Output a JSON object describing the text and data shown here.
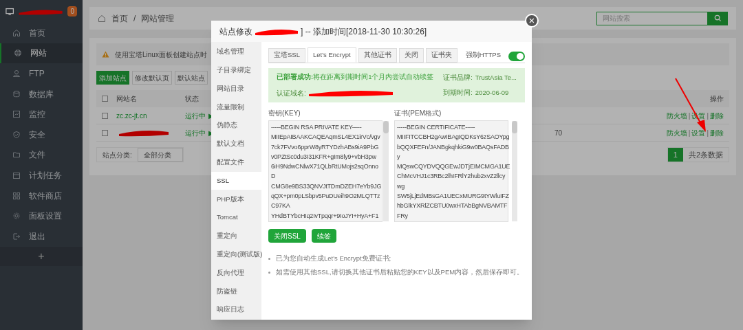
{
  "sidebar": {
    "logo": {
      "redacted": true
    },
    "badge": "0",
    "items": [
      {
        "label": "首页",
        "selected": false
      },
      {
        "label": "网站",
        "selected": true
      },
      {
        "label": "FTP",
        "selected": false
      },
      {
        "label": "数据库",
        "selected": false
      },
      {
        "label": "监控",
        "selected": false
      },
      {
        "label": "安全",
        "selected": false
      },
      {
        "label": "文件",
        "selected": false
      },
      {
        "label": "计划任务",
        "selected": false
      },
      {
        "label": "软件商店",
        "selected": false
      },
      {
        "label": "面板设置",
        "selected": false
      },
      {
        "label": "退出",
        "selected": false
      }
    ],
    "add": "+"
  },
  "breadcrumb": [
    "首页",
    "/",
    "网站管理"
  ],
  "search": {
    "placeholder": "网站搜索"
  },
  "notice": "使用宝塔Linux面板创建站点时",
  "toolbar": [
    "添加站点",
    "修改默认页",
    "默认站点"
  ],
  "table": {
    "columns": [
      "网站名",
      "状态",
      "操作"
    ],
    "all_checked": false,
    "rows": [
      {
        "checked": false,
        "name": "zc.zc-jt.cn",
        "redacted": false,
        "status": "运行中",
        "play": "▶",
        "extra": "",
        "actions": [
          "防火墙",
          "|",
          "设置",
          "|",
          "删除"
        ]
      },
      {
        "checked": false,
        "name": "",
        "redacted": true,
        "status": "运行中",
        "play": "▶",
        "extra": "70",
        "actions": [
          "防火墙",
          "|",
          "设置",
          "|",
          "删除"
        ]
      }
    ]
  },
  "category": {
    "label": "站点分类:",
    "value": "全部分类"
  },
  "pagination": {
    "page": "1",
    "total": "共2条数据"
  },
  "modal": {
    "title_prefix": "站点修改",
    "title_suffix": "] -- 添加时间[2018-11-30 10:30:26]",
    "close": "×",
    "menu": [
      {
        "label": "域名管理",
        "selected": false
      },
      {
        "label": "子目录绑定",
        "selected": false
      },
      {
        "label": "网站目录",
        "selected": false
      },
      {
        "label": "流量限制",
        "selected": false
      },
      {
        "label": "伪静态",
        "selected": false
      },
      {
        "label": "默认文档",
        "selected": false
      },
      {
        "label": "配置文件",
        "selected": false
      },
      {
        "label": "SSL",
        "selected": true
      },
      {
        "label": "PHP版本",
        "selected": false
      },
      {
        "label": "Tomcat",
        "selected": false
      },
      {
        "label": "重定向",
        "selected": false
      },
      {
        "label": "重定向(测试版)",
        "selected": false
      },
      {
        "label": "反向代理",
        "selected": false
      },
      {
        "label": "防盗链",
        "selected": false
      },
      {
        "label": "响应日志",
        "selected": false
      }
    ],
    "tabs": [
      {
        "label": "宝塔SSL",
        "selected": false
      },
      {
        "label": "Let's Encrypt",
        "selected": true
      },
      {
        "label": "其他证书",
        "selected": false
      },
      {
        "label": "关闭",
        "selected": false
      },
      {
        "label": "证书夹",
        "selected": false
      }
    ],
    "force_https": {
      "label": "强制HTTPS",
      "on": true
    },
    "status": {
      "deployed": "**已部署成功:**将在距离到期时间1个月内尝试自动续签",
      "domain_label": "认证域名:",
      "brand_label": "证书品牌:",
      "brand": "TrustAsia Te...",
      "expiry_label": "到期时间:",
      "expiry": "2020-06-09"
    },
    "key": {
      "label": "密钥(KEY)",
      "value": "-----BEGIN RSA PRIVATE KEY-----\nMIIEpAIBAAKCAQEAqmSL4EX1irVc/vgv\n7ck7FVvo6pprW8yRTYDzhABs9iA9PbG\nv0PZtSc0du3I31KFR+gIm8ly9+vbH3pw\n6iH9NdwCNlwX71QLbRtUMojs2sqOnno\nD\nCMG8e9BS33QNVJtTDmDZEH7eYb9JG\nqQX+pm0pLSbpv5PuDUeih9O2MLQTTz\nC97KA\nYHdBTYbcHIq2IvTpqqr+9IoJYI+HyA+F1"
    },
    "cert": {
      "label": "证书(PEM格式)",
      "value": "-----BEGIN CERTIFICATE-----\nMIIFITCCBH2gAwIBAgIQDKsY6zSAOYpg\nbQQXFEFn/JANBgkqhkiG9w0BAQsFADB\ny\nMQswCQYDVQQGEwJDTjEIMCMGA1UE\nChMcVHJ1c3RBc2lhIFRlY2hub2xvZ2llcy\nwg\nSW5jLjEdMBsGA1UECxMURG9tYWluIFZ\nhbGlkYXRlZCBTU0wxHTAbBgNVBAMTF\nFRy"
    },
    "buttons": [
      "关闭SSL",
      "续签"
    ],
    "notes": [
      "已为您自动生成Let's Encrypt免费证书;",
      "如需使用其他SSL,请切换其他证书后粘贴您的KEY以及PEM内容，然后保存即可。"
    ]
  }
}
